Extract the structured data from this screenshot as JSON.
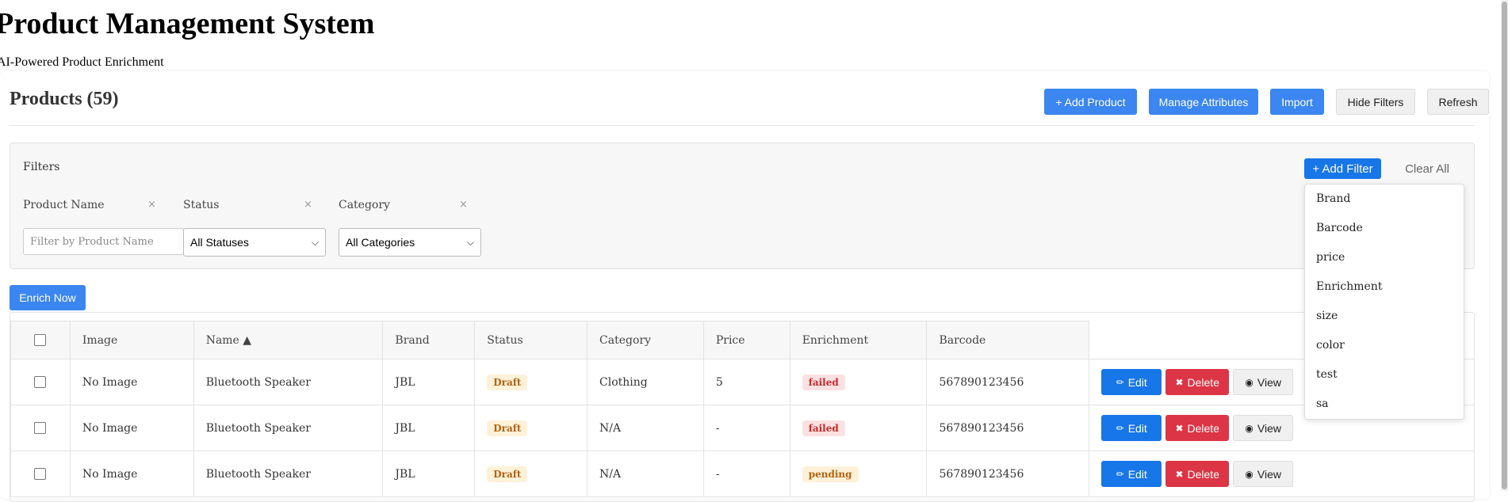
{
  "header": {
    "title": "Product Management System",
    "subtitle": "AI-Powered Product Enrichment"
  },
  "products": {
    "title": "Products (59)",
    "buttons": {
      "add_product": "+ Add Product",
      "manage_attributes": "Manage Attributes",
      "import": "Import",
      "hide_filters": "Hide Filters",
      "refresh": "Refresh"
    }
  },
  "filters": {
    "label": "Filters",
    "add_filter": "+ Add Filter",
    "clear_all": "Clear All",
    "product_name": {
      "label": "Product Name",
      "placeholder": "Filter by Product Name",
      "remove": "×"
    },
    "status": {
      "label": "Status",
      "selected": "All Statuses",
      "remove": "×"
    },
    "category": {
      "label": "Category",
      "selected": "All Categories",
      "remove": "×"
    },
    "add_filter_options": [
      "Brand",
      "Barcode",
      "price",
      "Enrichment",
      "size",
      "color",
      "test",
      "sa"
    ]
  },
  "enrich_now": "Enrich Now",
  "table": {
    "headers": {
      "image": "Image",
      "name": "Name ▲",
      "brand": "Brand",
      "status": "Status",
      "category": "Category",
      "price": "Price",
      "enrichment": "Enrichment",
      "barcode": "Barcode"
    },
    "rows": [
      {
        "image": "No Image",
        "name": "Bluetooth Speaker",
        "brand": "JBL",
        "status": "Draft",
        "category": "Clothing",
        "price": "5",
        "enrichment": "failed",
        "barcode": "567890123456"
      },
      {
        "image": "No Image",
        "name": "Bluetooth Speaker",
        "brand": "JBL",
        "status": "Draft",
        "category": "N/A",
        "price": "-",
        "enrichment": "failed",
        "barcode": "567890123456"
      },
      {
        "image": "No Image",
        "name": "Bluetooth Speaker",
        "brand": "JBL",
        "status": "Draft",
        "category": "N/A",
        "price": "-",
        "enrichment": "pending",
        "barcode": "567890123456"
      }
    ],
    "actions": {
      "edit": "Edit",
      "delete": "Delete",
      "view": "View"
    }
  },
  "icons": {
    "edit": "pencil-icon",
    "delete": "trash-icon",
    "view": "eye-icon",
    "select_arrow": "chevron-down-icon"
  },
  "colors": {
    "primary": "#3b86f0",
    "edit_button": "#1776e8",
    "delete_button": "#dc3545",
    "draft_badge_text": "#b5620f",
    "failed_badge_text": "#c62828"
  }
}
